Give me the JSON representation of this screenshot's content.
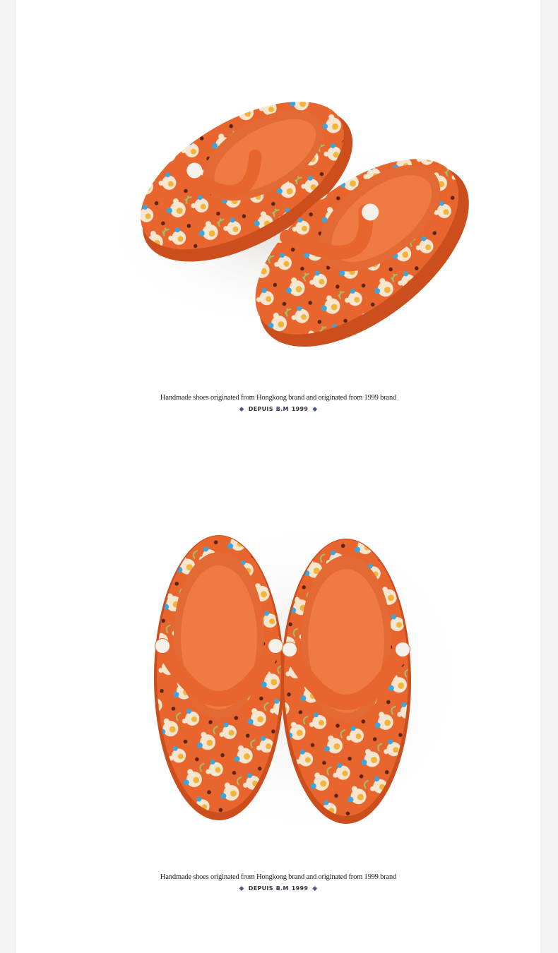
{
  "sections": [
    {
      "caption": "Handmade shoes originated from Hongkong brand and originated from 1999 brand",
      "brand": {
        "left": "DEPUIS",
        "mark": "B.M",
        "year": "1999"
      },
      "photo": {
        "type": "product-photo",
        "subject": "pair of orange kids clogs, three-quarter view"
      }
    },
    {
      "caption": "Handmade shoes originated from Hongkong brand and originated from 1999 brand",
      "brand": {
        "left": "DEPUIS",
        "mark": "B.M",
        "year": "1999"
      },
      "photo": {
        "type": "product-photo",
        "subject": "pair of orange kids clogs, top view"
      }
    }
  ],
  "colors": {
    "background": "#f3f3f3",
    "card": "#ffffff",
    "shoe_orange": "#e8652e",
    "shoe_dark": "#cc4e1c",
    "bear_cream": "#f7e6cf",
    "accent_yellow": "#f3b43a",
    "accent_blue": "#3aa6e0",
    "leaf_green": "#9bc36a",
    "diamond": "#4c5a86"
  },
  "icons": [
    "diamond-icon"
  ]
}
